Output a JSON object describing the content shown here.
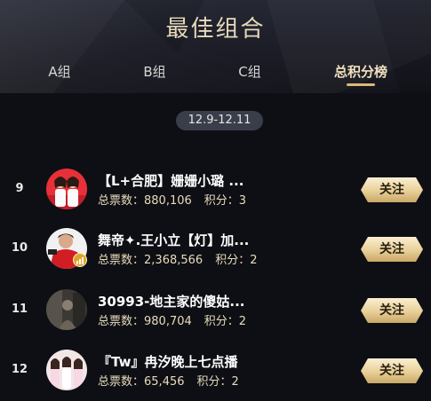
{
  "header": {
    "title": "最佳组合"
  },
  "tabs": [
    {
      "label": "A组",
      "active": false
    },
    {
      "label": "B组",
      "active": false
    },
    {
      "label": "C组",
      "active": false
    },
    {
      "label": "总积分榜",
      "active": true
    }
  ],
  "date_range": "12.9-12.11",
  "rows": [
    {
      "rank": "9",
      "name": "【L+合肥】姗姗小璐 ...",
      "votes_label": "总票数：",
      "votes": "880,106",
      "points_label": "积分：",
      "points": "3",
      "follow_label": "关注",
      "avatar_icon": "two-women-photo-icon"
    },
    {
      "rank": "10",
      "name": "舞帝✦.王小立【灯】加...",
      "votes_label": "总票数：",
      "votes": "2,368,566",
      "points_label": "积分：",
      "points": "2",
      "follow_label": "关注",
      "avatar_icon": "man-red-shirt-photo-icon"
    },
    {
      "rank": "11",
      "name": "30993-地主家的傻姑...",
      "votes_label": "总票数：",
      "votes": "980,704",
      "points_label": "积分：",
      "points": "2",
      "follow_label": "关注",
      "avatar_icon": "dim-room-photo-icon"
    },
    {
      "rank": "12",
      "name": "『Tw』冉汐晚上七点播",
      "votes_label": "总票数：",
      "votes": "65,456",
      "points_label": "积分：",
      "points": "2",
      "follow_label": "关注",
      "avatar_icon": "group-women-photo-icon"
    }
  ],
  "colors": {
    "background": "#0e0f14",
    "title_gold": "#e7d9bb",
    "stats_gold": "#e9dcbc",
    "button_gold": "#e8cf98",
    "pill_bg": "#3a3d4a"
  }
}
